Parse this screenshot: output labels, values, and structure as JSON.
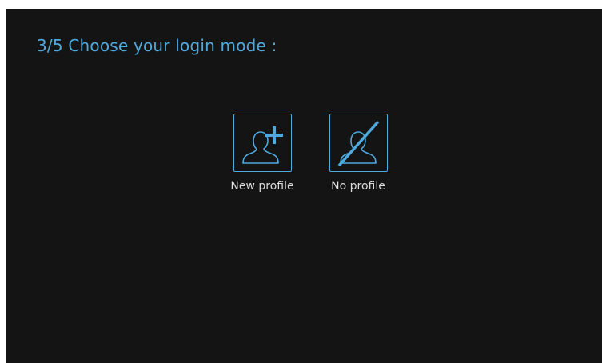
{
  "screen": {
    "title": "3/5 Choose your login mode :"
  },
  "options": [
    {
      "label": "New profile",
      "icon": "user-add-icon"
    },
    {
      "label": "No profile",
      "icon": "user-disabled-icon"
    }
  ],
  "colors": {
    "background": "#141414",
    "accent": "#4fa9dd",
    "label_text": "#dcdcdc"
  }
}
